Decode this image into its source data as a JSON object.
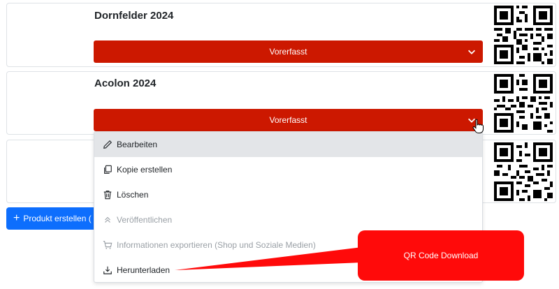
{
  "products": [
    {
      "title": "Dornfelder 2024",
      "status": "Vorerfasst"
    },
    {
      "title": "Acolon 2024",
      "status": "Vorerfasst"
    }
  ],
  "dropdown": {
    "items": [
      {
        "label": "Bearbeiten",
        "icon": "pencil-icon",
        "state": "hover"
      },
      {
        "label": "Kopie erstellen",
        "icon": "copy-icon",
        "state": "normal"
      },
      {
        "label": "Löschen",
        "icon": "trash-icon",
        "state": "normal"
      },
      {
        "label": "Veröffentlichen",
        "icon": "chevrons-up-icon",
        "state": "disabled"
      },
      {
        "label": "Informationen exportieren (Shop und Soziale Medien)",
        "icon": "cart-icon",
        "state": "disabled"
      },
      {
        "label": "Herunterladen",
        "icon": "download-icon",
        "state": "normal"
      }
    ]
  },
  "create_button": {
    "label": "Produkt erstellen ("
  },
  "callout": {
    "text": "QR Code Download",
    "color": "#ff0a0a"
  },
  "colors": {
    "status": "#cc1800",
    "primary": "#0d6efd"
  }
}
